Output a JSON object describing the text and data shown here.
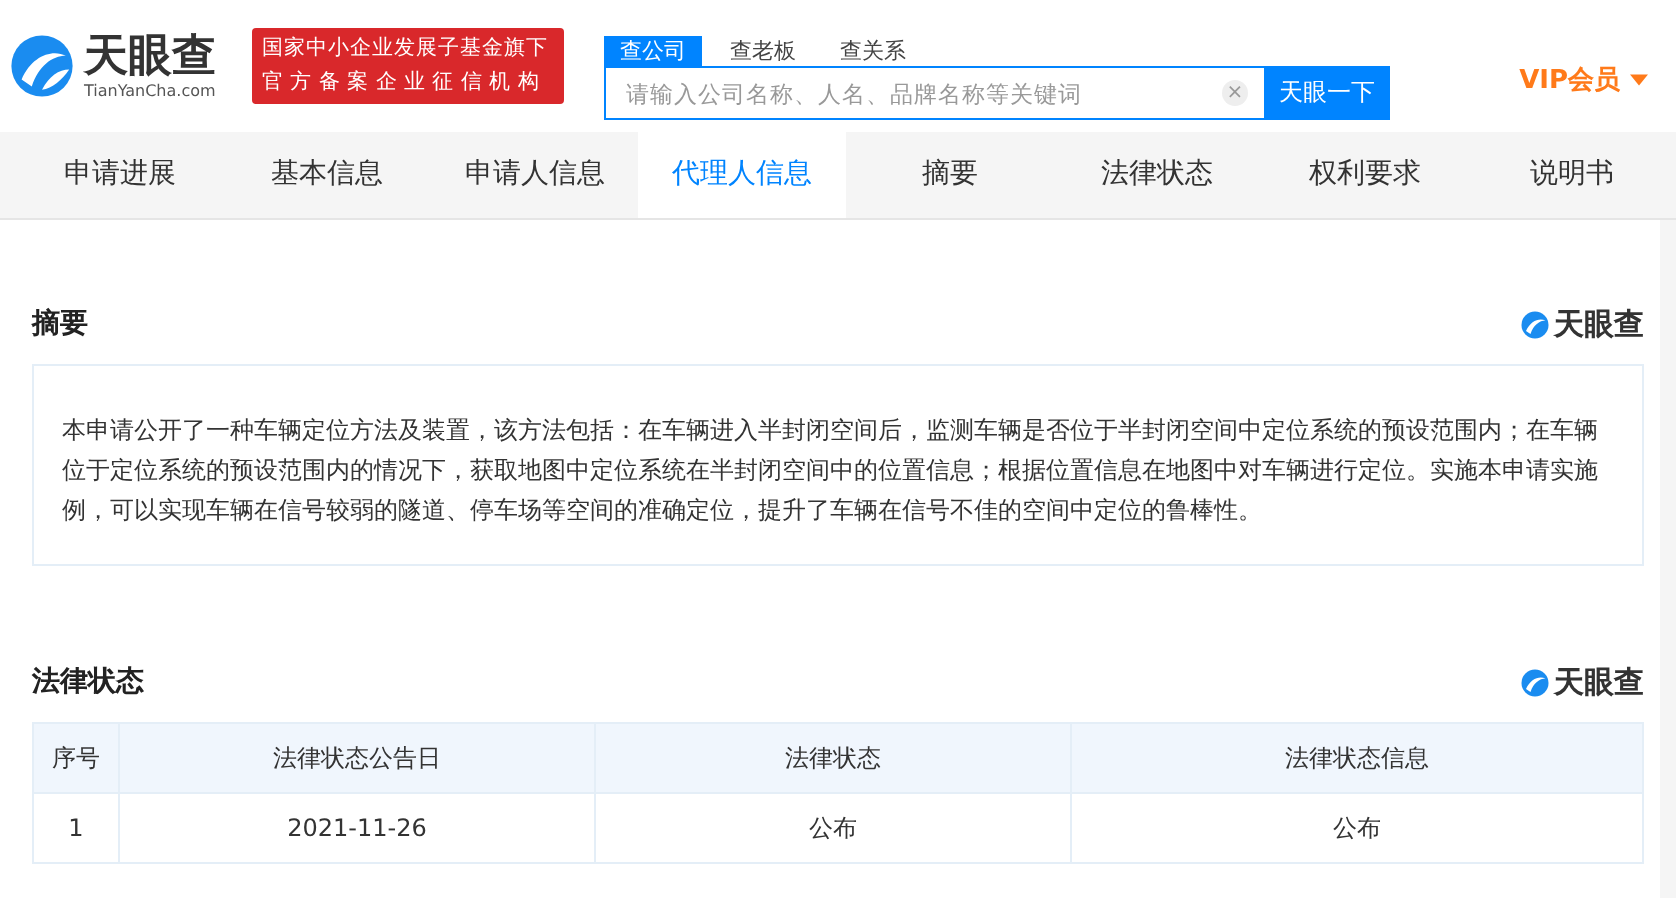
{
  "header": {
    "logo": {
      "name": "天眼查",
      "domain": "TianYanCha.com"
    },
    "badge": [
      "国家中小企业发展子基金旗下",
      "官方备案企业征信机构"
    ],
    "search_tabs": [
      {
        "label": "查公司",
        "selected": true
      },
      {
        "label": "查老板",
        "selected": false
      },
      {
        "label": "查关系",
        "selected": false
      }
    ],
    "search": {
      "placeholder": "请输入公司名称、人名、品牌名称等关键词",
      "clear": "×",
      "button": "天眼一下"
    },
    "vip": "VIP会员"
  },
  "tabs": [
    {
      "label": "申请进展",
      "selected": false
    },
    {
      "label": "基本信息",
      "selected": false
    },
    {
      "label": "申请人信息",
      "selected": false
    },
    {
      "label": "代理人信息",
      "selected": true
    },
    {
      "label": "摘要",
      "selected": false
    },
    {
      "label": "法律状态",
      "selected": false
    },
    {
      "label": "权利要求",
      "selected": false
    },
    {
      "label": "说明书",
      "selected": false
    }
  ],
  "abstract": {
    "title": "摘要",
    "brand": "天眼查",
    "text": "本申请公开了一种车辆定位方法及装置，该方法包括：在车辆进入半封闭空间后，监测车辆是否位于半封闭空间中定位系统的预设范围内；在车辆位于定位系统的预设范围内的情况下，获取地图中定位系统在半封闭空间中的位置信息；根据位置信息在地图中对车辆进行定位。实施本申请实施例，可以实现车辆在信号较弱的隧道、停车场等空间的准确定位，提升了车辆在信号不佳的空间中定位的鲁棒性。"
  },
  "legal_status": {
    "title": "法律状态",
    "brand": "天眼查",
    "columns": [
      "序号",
      "法律状态公告日",
      "法律状态",
      "法律状态信息"
    ],
    "rows": [
      [
        "1",
        "2021-11-26",
        "公布",
        "公布"
      ]
    ]
  }
}
